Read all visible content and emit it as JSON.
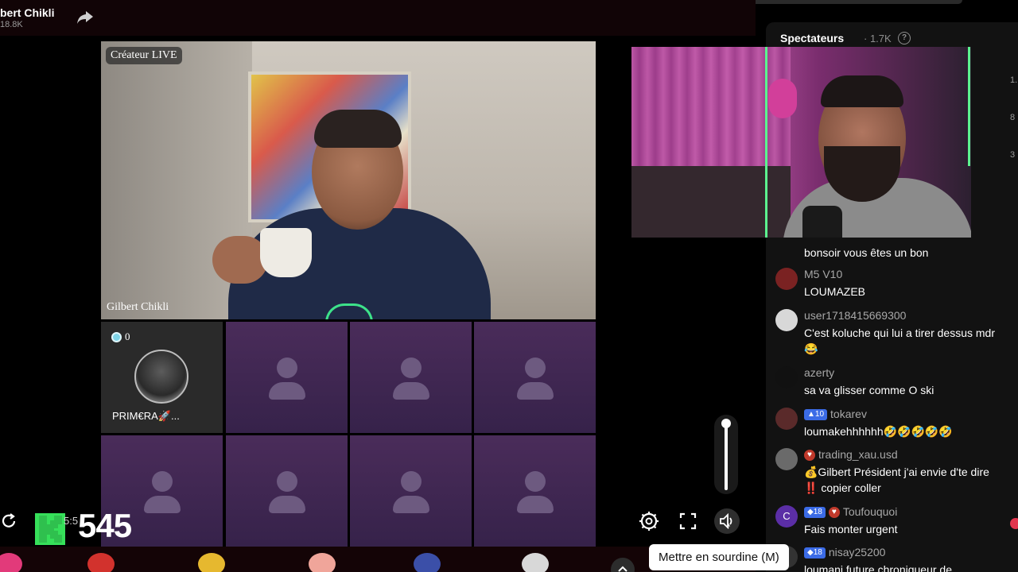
{
  "top": {
    "username": "bert Chikli",
    "followers": "18.8K"
  },
  "main_video": {
    "creator_tag": "Créateur LIVE",
    "host_name": "Gilbert Chikli"
  },
  "guests": [
    {
      "name": "PRIM€RA🚀...",
      "coins": "0"
    }
  ],
  "panel": {
    "title": "Spectateurs",
    "count": "· 1.7K",
    "help": "?",
    "edge_digits": [
      "1.",
      "8",
      "3"
    ]
  },
  "chat": [
    {
      "user": "",
      "text": "bonsoir vous êtes un bon",
      "avatar_color": "#333333"
    },
    {
      "user": "M5 V10",
      "text": "LOUMAZEB",
      "avatar_color": "#7a2222"
    },
    {
      "user": "user1718415669300",
      "text": "C'est koluche qui lui a tirer dessus mdr 😂",
      "avatar_color": "#d8d8d8"
    },
    {
      "user": "azerty",
      "text": "sa va glisser comme O ski",
      "avatar_color": "#111111"
    },
    {
      "user": "tokarev",
      "badge": "▲10",
      "text": "loumakehhhhhh🤣🤣🤣🤣🤣",
      "avatar_color": "#5a2a2a"
    },
    {
      "user": "trading_xau.usd",
      "badge_heart": "♥",
      "text": "💰Gilbert Président j'ai envie d'te dire ‼️ copier coller",
      "avatar_color": "#6a6a6a"
    },
    {
      "user": "Toufouquoi",
      "badge": "◆18",
      "badge_heart": "♥",
      "text": "Fais monter urgent",
      "avatar_color": "#5b2ea6",
      "avatar_letter": "C"
    },
    {
      "user": "nisay25200",
      "badge": "◆18",
      "text": "loumani future chroniqueur de",
      "avatar_color": "#333333"
    }
  ],
  "overlay": {
    "k_time": "5:5",
    "k_count": "545"
  },
  "controls": {
    "tooltip": "Mettre en sourdine (M)"
  },
  "colors": {
    "accent_green": "#36e05a",
    "tile_purple": "#3f2650",
    "panel_bg": "#121212"
  }
}
